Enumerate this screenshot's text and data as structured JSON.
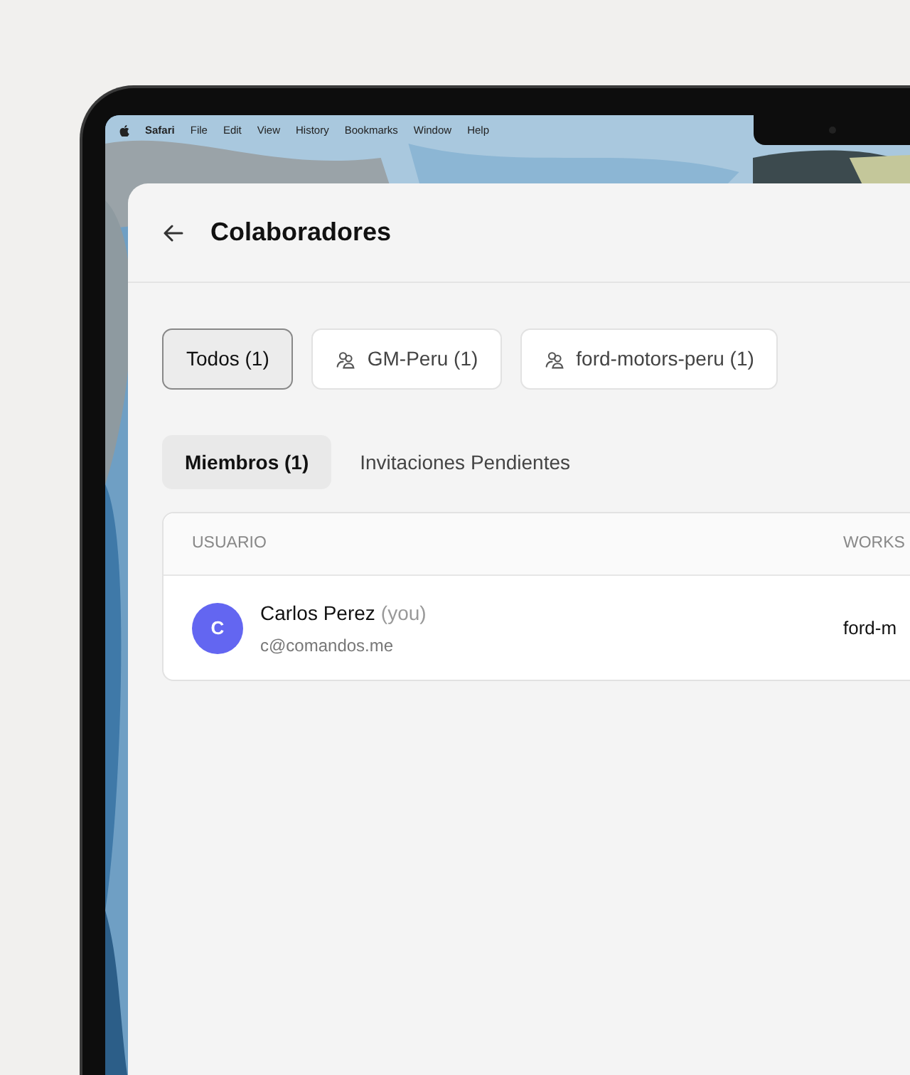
{
  "menu_bar": {
    "app": "Safari",
    "items": [
      "File",
      "Edit",
      "View",
      "History",
      "Bookmarks",
      "Window",
      "Help"
    ]
  },
  "header": {
    "title": "Colaboradores"
  },
  "filters": [
    {
      "label": "Todos (1)",
      "kind": "all",
      "selected": true
    },
    {
      "label": "GM-Peru (1)",
      "kind": "group",
      "selected": false
    },
    {
      "label": "ford-motors-peru (1)",
      "kind": "group",
      "selected": false
    }
  ],
  "tabs": [
    {
      "label": "Miembros (1)",
      "selected": true
    },
    {
      "label": "Invitaciones Pendientes",
      "selected": false
    }
  ],
  "table": {
    "columns": [
      "USUARIO",
      "WORKS"
    ],
    "rows": [
      {
        "avatar": "C",
        "name": "Carlos Perez",
        "note": "(you)",
        "email": "c@comandos.me",
        "column_2": "ford-m"
      }
    ]
  }
}
